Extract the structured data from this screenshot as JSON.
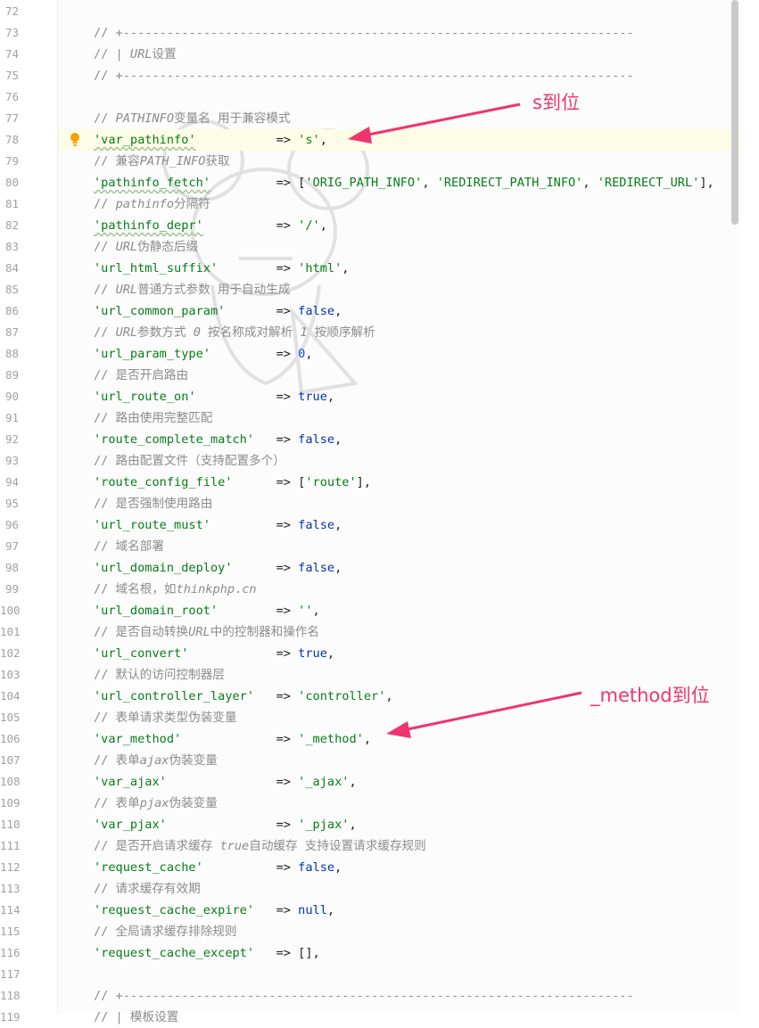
{
  "colors": {
    "comment": "#8c8c8c",
    "string": "#067d17",
    "keyword": "#0033b3",
    "number": "#1750eb",
    "annotation": "#f0346f",
    "current_line": "#fdfce6"
  },
  "lines": [
    {
      "n": "72",
      "text": ""
    },
    {
      "n": "73",
      "text": "// +----------------------------------------------------------------------"
    },
    {
      "n": "74",
      "text": "// | URL设置"
    },
    {
      "n": "75",
      "text": "// +----------------------------------------------------------------------"
    },
    {
      "n": "76",
      "text": ""
    },
    {
      "n": "77",
      "text": "// PATHINFO变量名 用于兼容模式"
    },
    {
      "n": "78",
      "text": "'var_pathinfo'           => 's',"
    },
    {
      "n": "79",
      "text": "// 兼容PATH_INFO获取"
    },
    {
      "n": "80",
      "text": "'pathinfo_fetch'         => ['ORIG_PATH_INFO', 'REDIRECT_PATH_INFO', 'REDIRECT_URL'],"
    },
    {
      "n": "81",
      "text": "// pathinfo分隔符"
    },
    {
      "n": "82",
      "text": "'pathinfo_depr'          => '/',"
    },
    {
      "n": "83",
      "text": "// URL伪静态后缀"
    },
    {
      "n": "84",
      "text": "'url_html_suffix'        => 'html',"
    },
    {
      "n": "85",
      "text": "// URL普通方式参数 用于自动生成"
    },
    {
      "n": "86",
      "text": "'url_common_param'       => false,"
    },
    {
      "n": "87",
      "text": "// URL参数方式 0 按名称成对解析 1 按顺序解析"
    },
    {
      "n": "88",
      "text": "'url_param_type'         => 0,"
    },
    {
      "n": "89",
      "text": "// 是否开启路由"
    },
    {
      "n": "90",
      "text": "'url_route_on'           => true,"
    },
    {
      "n": "91",
      "text": "// 路由使用完整匹配"
    },
    {
      "n": "92",
      "text": "'route_complete_match'   => false,"
    },
    {
      "n": "93",
      "text": "// 路由配置文件（支持配置多个）"
    },
    {
      "n": "94",
      "text": "'route_config_file'      => ['route'],"
    },
    {
      "n": "95",
      "text": "// 是否强制使用路由"
    },
    {
      "n": "96",
      "text": "'url_route_must'         => false,"
    },
    {
      "n": "97",
      "text": "// 域名部署"
    },
    {
      "n": "98",
      "text": "'url_domain_deploy'      => false,"
    },
    {
      "n": "99",
      "text": "// 域名根，如thinkphp.cn"
    },
    {
      "n": "100",
      "text": "'url_domain_root'        => '',"
    },
    {
      "n": "101",
      "text": "// 是否自动转换URL中的控制器和操作名"
    },
    {
      "n": "102",
      "text": "'url_convert'            => true,"
    },
    {
      "n": "103",
      "text": "// 默认的访问控制器层"
    },
    {
      "n": "104",
      "text": "'url_controller_layer'   => 'controller',"
    },
    {
      "n": "105",
      "text": "// 表单请求类型伪装变量"
    },
    {
      "n": "106",
      "text": "'var_method'             => '_method',"
    },
    {
      "n": "107",
      "text": "// 表单ajax伪装变量"
    },
    {
      "n": "108",
      "text": "'var_ajax'               => '_ajax',"
    },
    {
      "n": "109",
      "text": "// 表单pjax伪装变量"
    },
    {
      "n": "110",
      "text": "'var_pjax'               => '_pjax',"
    },
    {
      "n": "111",
      "text": "// 是否开启请求缓存 true自动缓存 支持设置请求缓存规则"
    },
    {
      "n": "112",
      "text": "'request_cache'          => false,"
    },
    {
      "n": "113",
      "text": "// 请求缓存有效期"
    },
    {
      "n": "114",
      "text": "'request_cache_expire'   => null,"
    },
    {
      "n": "115",
      "text": "// 全局请求缓存排除规则"
    },
    {
      "n": "116",
      "text": "'request_cache_except'   => [],"
    },
    {
      "n": "117",
      "text": ""
    },
    {
      "n": "118",
      "text": "// +----------------------------------------------------------------------"
    },
    {
      "n": "119",
      "text": "// | 模板设置"
    }
  ],
  "annotations": [
    {
      "text": "s到位"
    },
    {
      "text": "_method到位"
    }
  ],
  "icons": {
    "gutter": "lightbulb-icon",
    "watermark": "mouse-mascot-watermark"
  },
  "editor": {
    "current_line": "78"
  }
}
